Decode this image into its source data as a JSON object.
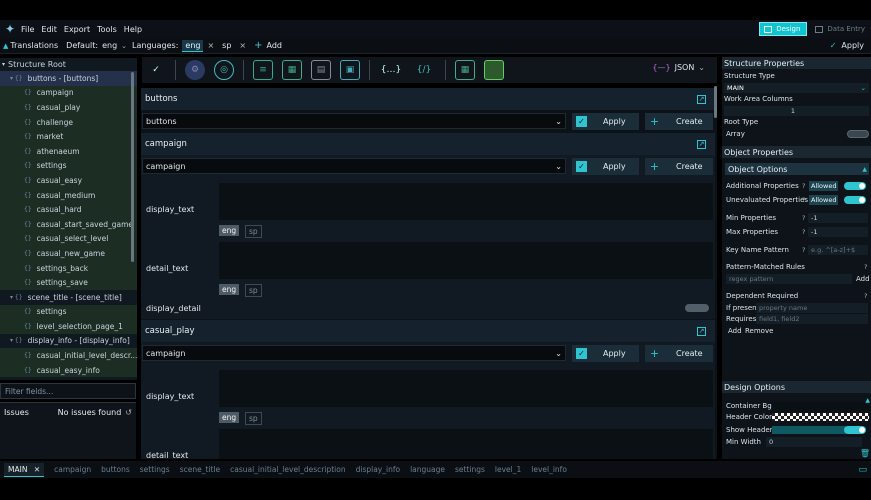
{
  "menu": [
    "File",
    "Edit",
    "Export",
    "Tools",
    "Help"
  ],
  "modes": {
    "design": "Design",
    "data_entry": "Data Entry"
  },
  "langbar": {
    "translations": "Translations",
    "default_label": "Default:",
    "default_value": "eng",
    "languages_label": "Languages:",
    "languages": [
      "eng",
      "sp"
    ],
    "add": "Add",
    "apply": "Apply"
  },
  "tree": {
    "root": "Structure Root",
    "items": [
      {
        "label": "buttons - [buttons]",
        "kind": "group"
      },
      {
        "label": "campaign",
        "kind": "child"
      },
      {
        "label": "casual_play",
        "kind": "child"
      },
      {
        "label": "challenge",
        "kind": "child"
      },
      {
        "label": "market",
        "kind": "child"
      },
      {
        "label": "athenaeum",
        "kind": "child"
      },
      {
        "label": "settings",
        "kind": "child"
      },
      {
        "label": "casual_easy",
        "kind": "child"
      },
      {
        "label": "casual_medium",
        "kind": "child"
      },
      {
        "label": "casual_hard",
        "kind": "child"
      },
      {
        "label": "casual_start_saved_game",
        "kind": "child"
      },
      {
        "label": "casual_select_level",
        "kind": "child"
      },
      {
        "label": "casual_new_game",
        "kind": "child"
      },
      {
        "label": "settings_back",
        "kind": "child"
      },
      {
        "label": "settings_save",
        "kind": "child"
      },
      {
        "label": "scene_title - [scene_title]",
        "kind": "group"
      },
      {
        "label": "settings",
        "kind": "child"
      },
      {
        "label": "level_selection_page_1",
        "kind": "child"
      },
      {
        "label": "display_info - [display_info]",
        "kind": "group"
      },
      {
        "label": "casual_initial_level_descr...",
        "kind": "child"
      },
      {
        "label": "casual_easy_info",
        "kind": "child"
      }
    ]
  },
  "filter_placeholder": "Filter fields...",
  "issues": {
    "title": "Issues",
    "status": "No issues found"
  },
  "toolbar": {
    "format": "JSON"
  },
  "center": {
    "apply": "Apply",
    "create": "Create",
    "sections": [
      {
        "header": "buttons",
        "select": "buttons"
      },
      {
        "header": "campaign",
        "select": "campaign",
        "fields": [
          "display_text",
          "detail_text",
          "display_detail"
        ]
      },
      {
        "header": "casual_play",
        "select": "campaign",
        "fields": [
          "display_text",
          "detail_text"
        ]
      }
    ],
    "langs": [
      "eng",
      "sp"
    ]
  },
  "right": {
    "structure_title": "Structure Properties",
    "structure_type_label": "Structure Type",
    "structure_type_value": "MAIN",
    "work_area_label": "Work Area Columns",
    "work_area_value": "1",
    "root_type_label": "Root Type",
    "root_type_value": "Array",
    "object_title": "Object Properties",
    "object_options": "Object Options",
    "additional_props": "Additional Properties",
    "unevaluated_props": "Unevaluated Properties",
    "allowed": "Allowed",
    "min_props": "Min Properties",
    "max_props": "Max Properties",
    "min_value": "-1",
    "max_value": "-1",
    "key_pattern": "Key Name Pattern",
    "key_pattern_placeholder": "e.g. ^[a-z]+$",
    "pattern_rules": "Pattern-Matched Rules",
    "regex_placeholder": "regex pattern",
    "add": "Add",
    "dependent_required": "Dependent Required",
    "if_present": "If present:",
    "if_present_placeholder": "property name",
    "requires": "Requires:",
    "requires_placeholder": "field1, field2",
    "remove": "Remove",
    "design_title": "Design Options",
    "container_bg": "Container Bg",
    "header_color": "Header Color",
    "show_header": "Show Header",
    "min_width": "Min Width",
    "min_width_value": "0",
    "q": "?"
  },
  "tabs": [
    "MAIN",
    "campaign",
    "buttons",
    "settings",
    "scene_title",
    "casual_initial_level_description",
    "display_info",
    "language",
    "settings",
    "level_1",
    "level_info"
  ],
  "colors": {
    "accent": "#2ec5d0",
    "bg": "#0c1217"
  }
}
